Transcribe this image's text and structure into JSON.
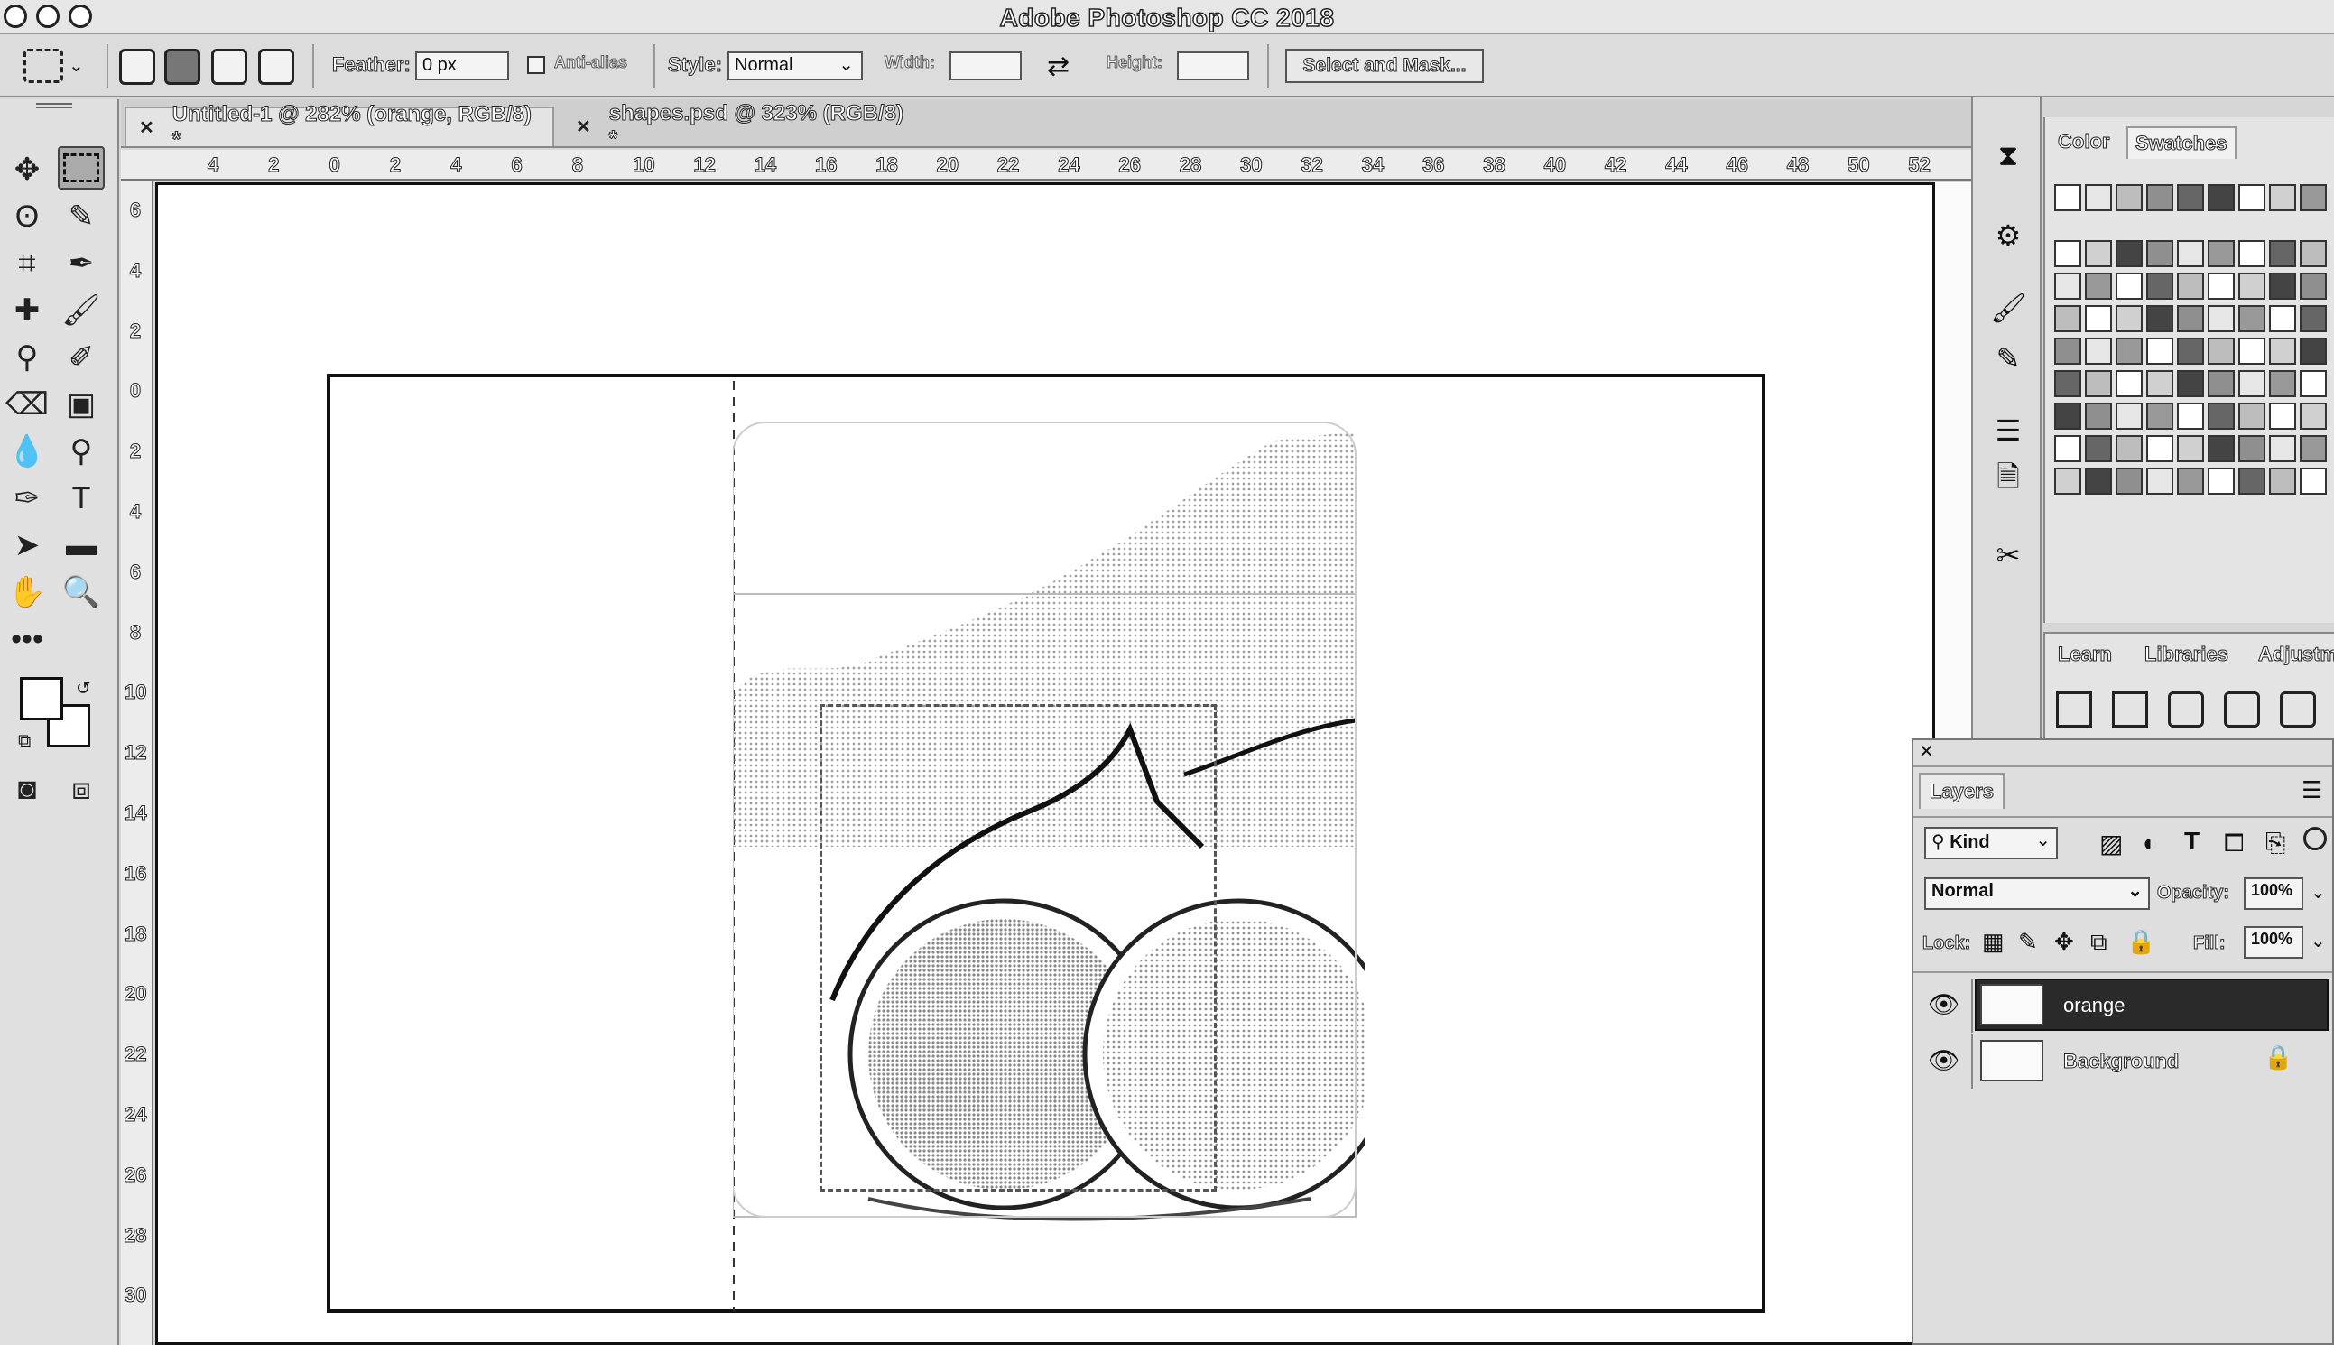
{
  "app": {
    "title": "Adobe Photoshop CC 2018"
  },
  "options": {
    "feather_label": "Feather:",
    "feather_value": "0 px",
    "antialias_label": "Anti-alias",
    "style_label": "Style:",
    "style_value": "Normal",
    "width_label": "Width:",
    "height_label": "Height:",
    "select_mask_label": "Select and Mask..."
  },
  "tabs": [
    {
      "label": "Untitled-1 @ 282% (orange, RGB/8) *",
      "active": true
    },
    {
      "label": "shapes.psd @ 323% (RGB/8) *",
      "active": false
    }
  ],
  "ruler_top": [
    "4",
    "2",
    "0",
    "2",
    "4",
    "6",
    "8",
    "10",
    "12",
    "14",
    "16",
    "18",
    "20",
    "22",
    "24",
    "26",
    "28",
    "30",
    "32",
    "34",
    "36",
    "38",
    "40",
    "42",
    "44",
    "46",
    "48",
    "50",
    "52"
  ],
  "ruler_left": [
    "6",
    "4",
    "2",
    "0",
    "2",
    "4",
    "6",
    "8",
    "10",
    "12",
    "14",
    "16",
    "18",
    "20",
    "22",
    "24",
    "26",
    "28",
    "30"
  ],
  "color_panel": {
    "tab_color": "Color",
    "tab_swatches": "Swatches"
  },
  "learn_panel": {
    "tab_learn": "Learn",
    "tab_libraries": "Libraries",
    "tab_adjust": "Adjustm"
  },
  "layers": {
    "title": "Layers",
    "filter_label": "Kind",
    "blend_mode": "Normal",
    "opacity_label": "Opacity:",
    "opacity_value": "100%",
    "lock_label": "Lock:",
    "fill_label": "Fill:",
    "fill_value": "100%",
    "items": [
      {
        "name": "orange",
        "selected": true
      },
      {
        "name": "Background",
        "selected": false
      }
    ]
  },
  "colors": {
    "chrome": "#dcdcdc",
    "selected_layer": "#2a2a2a",
    "canvas": "#ffffff"
  }
}
